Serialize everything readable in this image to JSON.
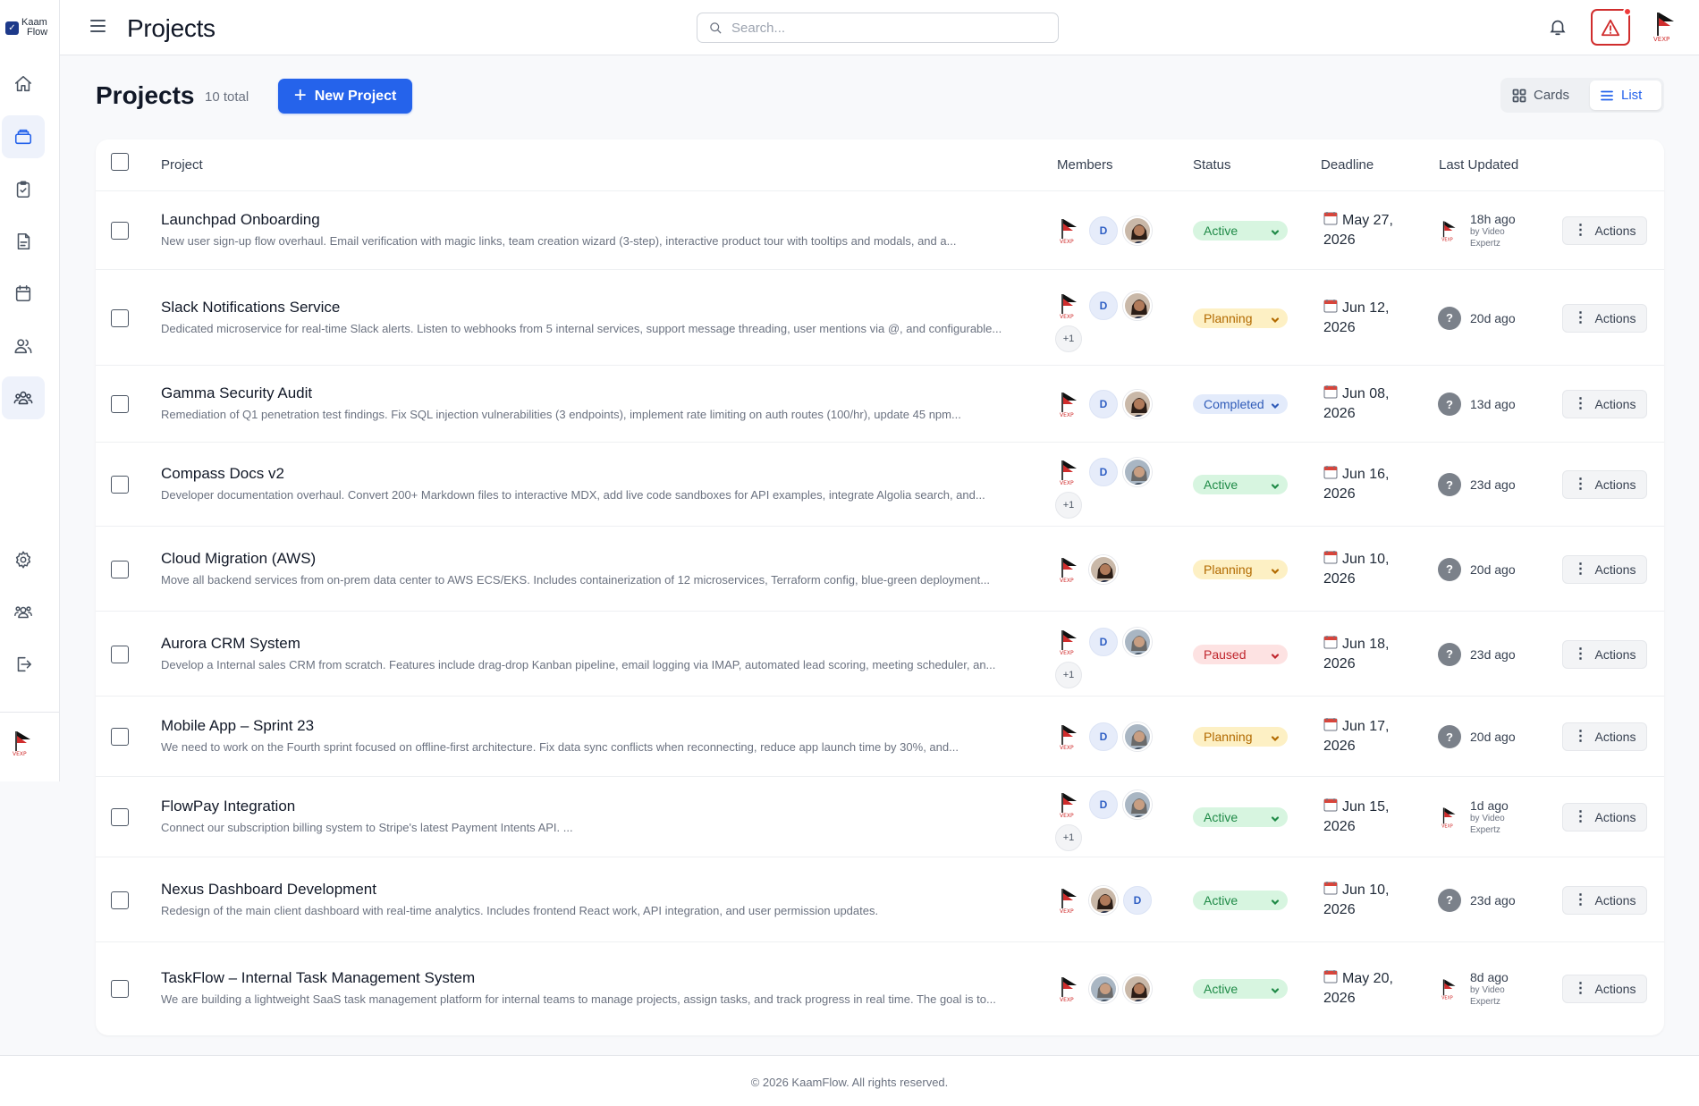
{
  "app": {
    "logo_text_1": "Kaam",
    "logo_text_2": "Flow",
    "header_title": "Projects",
    "search_placeholder": "Search..."
  },
  "page": {
    "title": "Projects",
    "total": "10 total",
    "new_button": "New Project",
    "view_cards": "Cards",
    "view_list": "List",
    "active_view": "List"
  },
  "columns": {
    "project": "Project",
    "members": "Members",
    "status": "Status",
    "deadline": "Deadline",
    "updated": "Last Updated"
  },
  "actions_label": "Actions",
  "rows": [
    {
      "name": "Launchpad Onboarding",
      "desc": "New user sign-up flow overhaul. Email verification with magic links, team creation wizard (3-step), interactive product tour with tooltips and modals, and a...",
      "members": [
        "logo",
        "D",
        "woman"
      ],
      "more": "",
      "status": "Active",
      "deadline_1": "May 27,",
      "deadline_2": "2026",
      "updated": "18h ago",
      "by": "by Video",
      "by2": "Expertz",
      "avatar": "logo"
    },
    {
      "name": "Slack Notifications Service",
      "desc": "Dedicated microservice for real-time Slack alerts. Listen to webhooks from 5 internal services, support message threading, user mentions via @, and configurable...",
      "members": [
        "logo",
        "D",
        "woman"
      ],
      "more": "+1",
      "status": "Planning",
      "deadline_1": "Jun 12,",
      "deadline_2": "2026",
      "updated": "20d ago",
      "by": "",
      "by2": "",
      "avatar": "?"
    },
    {
      "name": "Gamma Security Audit",
      "desc": "Remediation of Q1 penetration test findings. Fix SQL injection vulnerabilities (3 endpoints), implement rate limiting on auth routes (100/hr), update 45 npm...",
      "members": [
        "logo",
        "D",
        "woman"
      ],
      "more": "",
      "status": "Completed",
      "deadline_1": "Jun 08,",
      "deadline_2": "2026",
      "updated": "13d ago",
      "by": "",
      "by2": "",
      "avatar": "?"
    },
    {
      "name": "Compass Docs v2",
      "desc": "Developer documentation overhaul. Convert 200+ Markdown files to interactive MDX, add live code sandboxes for API examples, integrate Algolia search, and...",
      "members": [
        "logo",
        "D",
        "man"
      ],
      "more": "+1",
      "status": "Active",
      "deadline_1": "Jun 16,",
      "deadline_2": "2026",
      "updated": "23d ago",
      "by": "",
      "by2": "",
      "avatar": "?"
    },
    {
      "name": "Cloud Migration (AWS)",
      "desc": "Move all backend services from on-prem data center to AWS ECS/EKS. Includes containerization of 12 microservices, Terraform config, blue-green deployment...",
      "members": [
        "logo",
        "woman"
      ],
      "more": "",
      "status": "Planning",
      "deadline_1": "Jun 10,",
      "deadline_2": "2026",
      "updated": "20d ago",
      "by": "",
      "by2": "",
      "avatar": "?"
    },
    {
      "name": "Aurora CRM System",
      "desc": "Develop a Internal sales CRM from scratch. Features include drag-drop Kanban pipeline, email logging via IMAP, automated lead scoring, meeting scheduler, an...",
      "members": [
        "logo",
        "D",
        "man"
      ],
      "more": "+1",
      "status": "Paused",
      "deadline_1": "Jun 18,",
      "deadline_2": "2026",
      "updated": "23d ago",
      "by": "",
      "by2": "",
      "avatar": "?"
    },
    {
      "name": "Mobile App – Sprint 23",
      "desc": "We need to work on the Fourth sprint focused on offline-first architecture. Fix data sync conflicts when reconnecting, reduce app launch time by 30%, and...",
      "members": [
        "logo",
        "D",
        "man"
      ],
      "more": "",
      "status": "Planning",
      "deadline_1": "Jun 17,",
      "deadline_2": "2026",
      "updated": "20d ago",
      "by": "",
      "by2": "",
      "avatar": "?"
    },
    {
      "name": "FlowPay Integration",
      "desc": "Connect our subscription billing system to Stripe's latest Payment Intents API. ...",
      "members": [
        "logo",
        "D",
        "man"
      ],
      "more": "+1",
      "status": "Active",
      "deadline_1": "Jun 15,",
      "deadline_2": "2026",
      "updated": "1d ago",
      "by": "by Video",
      "by2": "Expertz",
      "avatar": "logo"
    },
    {
      "name": "Nexus Dashboard Development",
      "desc": "Redesign of the main client dashboard with real-time analytics. Includes frontend React work, API integration, and user permission updates.",
      "members": [
        "logo",
        "woman",
        "D"
      ],
      "more": "",
      "status": "Active",
      "deadline_1": "Jun 10,",
      "deadline_2": "2026",
      "updated": "23d ago",
      "by": "",
      "by2": "",
      "avatar": "?"
    },
    {
      "name": "TaskFlow – Internal Task Management System",
      "desc": "We are building a lightweight SaaS task management platform for internal teams to manage projects, assign tasks, and track progress in real time. The goal is to...",
      "members": [
        "logo",
        "man",
        "woman"
      ],
      "more": "",
      "status": "Active",
      "deadline_1": "May 20,",
      "deadline_2": "2026",
      "updated": "8d ago",
      "by": "by Video",
      "by2": "Expertz",
      "avatar": "logo"
    }
  ],
  "footer": "© 2026 KaamFlow. All rights reserved.",
  "colors": {
    "primary": "#2563eb",
    "alert": "#d02d2d",
    "active": "#1f8a47",
    "planning": "#b26a00",
    "completed": "#2f5bb8",
    "paused": "#c0262d"
  },
  "icons": {
    "sidebar": [
      "home-icon",
      "projects-icon",
      "tasks-icon",
      "documents-icon",
      "calendar-icon",
      "users-icon",
      "teams-icon",
      "settings-icon",
      "groups-icon",
      "logout-icon"
    ],
    "header": [
      "menu-icon",
      "search-icon",
      "bell-icon",
      "alert-triangle-icon"
    ]
  }
}
